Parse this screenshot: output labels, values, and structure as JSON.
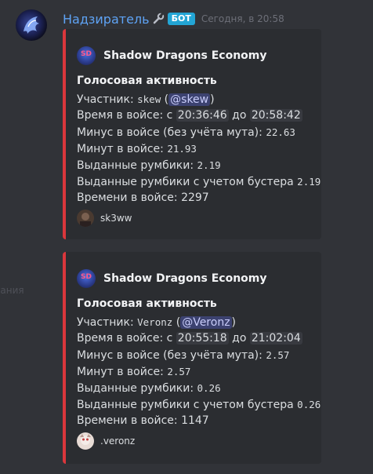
{
  "message": {
    "username": "Надзиратель",
    "badge": "БОТ",
    "timestamp": "Сегодня, в 20:58"
  },
  "colors": {
    "embed_border": "#da373c",
    "username": "#5ea3f5",
    "badge": "#23a5d5",
    "mention_bg": "#3c4270"
  },
  "side_text": "Сания",
  "embeds": [
    {
      "author": "Shadow Dragons Economy",
      "author_icon_text": "SD",
      "title": "Голосовая активность",
      "participant_label": "Участник:",
      "participant_user": "skew",
      "participant_mention": "@skew",
      "time_label": "Время в войсе: с",
      "time_from": "20:36:46",
      "time_to_label": "до",
      "time_to": "20:58:42",
      "minus_label": "Минус в войсе (без учёта мута):",
      "minus_value": "22.63",
      "minutes_label": "Минут в войсе:",
      "minutes_value": "21.93",
      "rumbik_label": "Выданные румбики:",
      "rumbik_value": "2.19",
      "booster_label": "Выданные румбики с учетом бустера",
      "booster_value": "2.19",
      "seconds_label": "Времени в войсе:",
      "seconds_value": "2297",
      "footer": "sk3ww"
    },
    {
      "author": "Shadow Dragons Economy",
      "author_icon_text": "SD",
      "title": "Голосовая активность",
      "participant_label": "Участник:",
      "participant_user": "Veronz",
      "participant_mention": "@Veronz",
      "time_label": "Время в войсе: с",
      "time_from": "20:55:18",
      "time_to_label": "до",
      "time_to": "21:02:04",
      "minus_label": "Минус в войсе (без учёта мута):",
      "minus_value": "2.57",
      "minutes_label": "Минут в войсе:",
      "minutes_value": "2.57",
      "rumbik_label": "Выданные румбики:",
      "rumbik_value": "0.26",
      "booster_label": "Выданные румбики с учетом бустера",
      "booster_value": "0.26",
      "seconds_label": "Времени в войсе:",
      "seconds_value": "1147",
      "footer": ".veronz"
    }
  ]
}
